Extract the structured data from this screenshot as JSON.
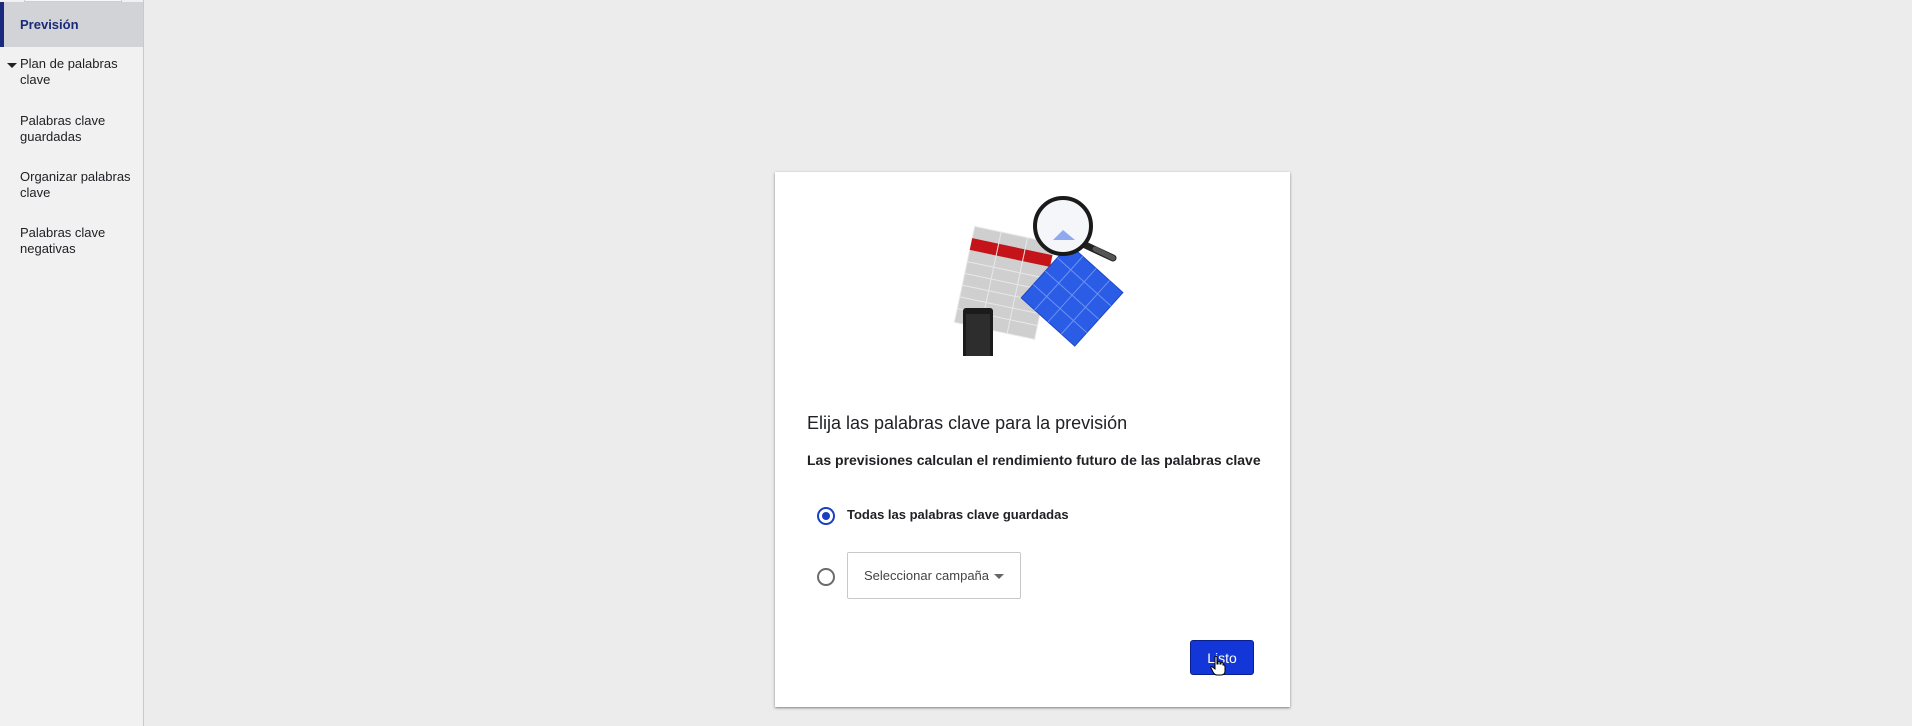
{
  "sidebar": {
    "items": [
      {
        "label": "Previsión",
        "active": true
      },
      {
        "label": "Plan de palabras clave",
        "expandable": true
      },
      {
        "label": "Palabras clave guardadas"
      },
      {
        "label": "Organizar palabras clave"
      },
      {
        "label": "Palabras clave negativas"
      }
    ]
  },
  "dialog": {
    "title": "Elija las palabras clave para la previsión",
    "subtitle": "Las previsiones calculan el rendimiento futuro de las palabras clave",
    "options": [
      {
        "label": "Todas las palabras clave guardadas",
        "selected": true
      },
      {
        "label": "",
        "selected": false
      }
    ],
    "campaign_select": {
      "value": "Seleccionar campaña"
    },
    "done_label": "Listo"
  },
  "colors": {
    "accent": "#1236d8",
    "nav_active_text": "#1a2a78",
    "radio_selected": "#1a3fbf"
  },
  "icons": [
    "caret-down-icon",
    "dropdown-arrow-icon",
    "hand-pointer-cursor-icon",
    "forecast-illustration"
  ]
}
